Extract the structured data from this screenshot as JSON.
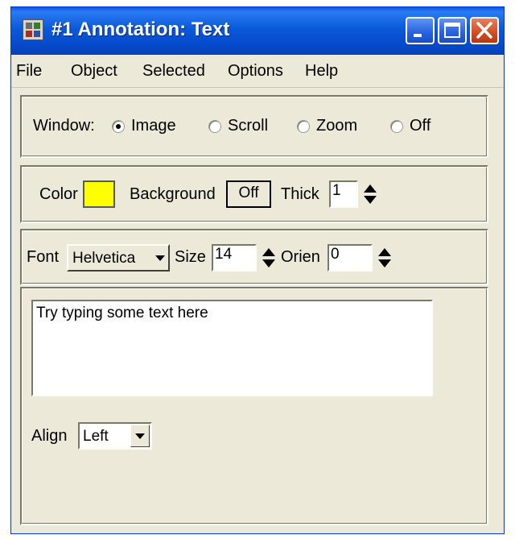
{
  "window": {
    "title": "#1 Annotation: Text",
    "buttons": {
      "minimize": "minimize",
      "maximize": "maximize",
      "close": "close"
    }
  },
  "menu": [
    "File",
    "Object",
    "Selected",
    "Options",
    "Help"
  ],
  "window_mode": {
    "label": "Window:",
    "options": [
      "Image",
      "Scroll",
      "Zoom",
      "Off"
    ],
    "selected": "Image"
  },
  "style": {
    "color_label": "Color",
    "color_value": "#ffff00",
    "background_label": "Background",
    "background_value": "Off",
    "thick_label": "Thick",
    "thick_value": "1"
  },
  "font": {
    "font_label": "Font",
    "font_value": "Helvetica",
    "size_label": "Size",
    "size_value": "14",
    "orien_label": "Orien",
    "orien_value": "0"
  },
  "text": {
    "content": "Try typing some text here",
    "align_label": "Align",
    "align_value": "Left"
  },
  "colors": {
    "titlebar": "#0b5ad9",
    "window_bg": "#ece9d8",
    "close_button": "#d34a20"
  }
}
